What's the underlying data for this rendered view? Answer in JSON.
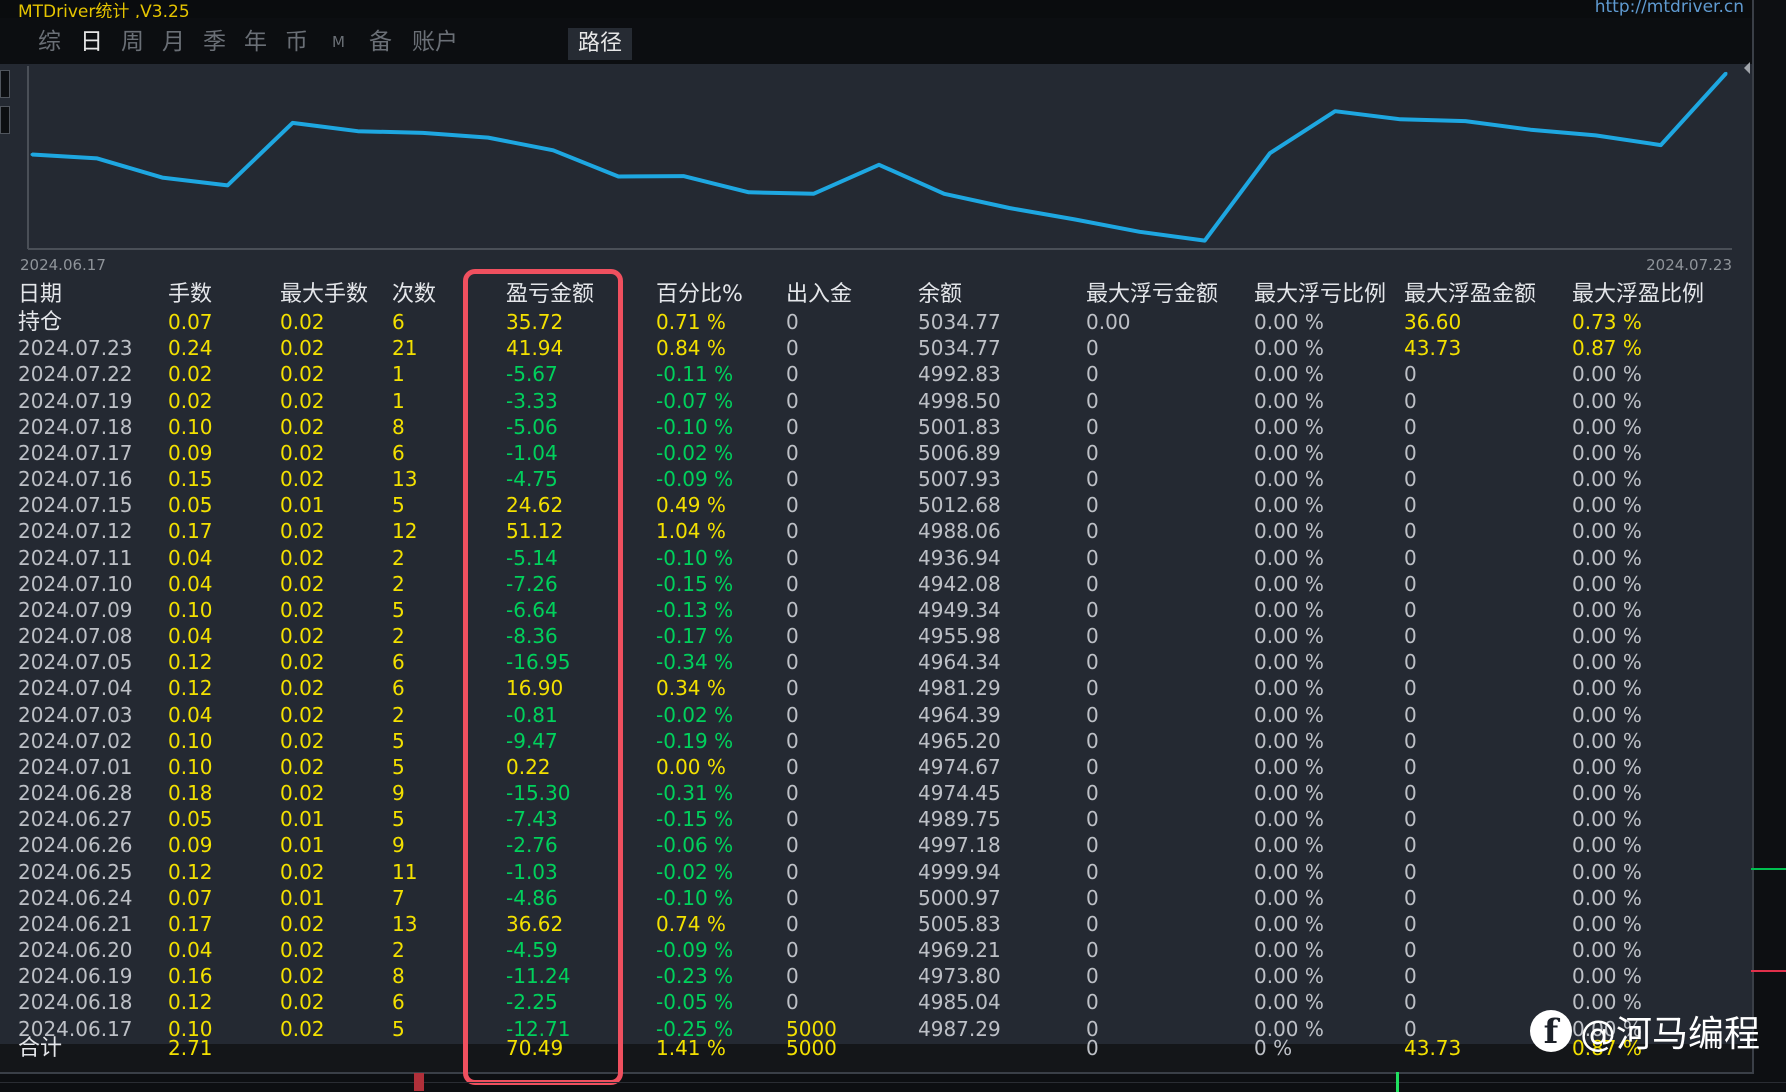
{
  "app": {
    "title": "MTDriver统计 ,V3.25",
    "url": "http://mtdriver.cn"
  },
  "tabs": [
    {
      "label": "综",
      "active": false
    },
    {
      "label": "日",
      "active": true
    },
    {
      "label": "周",
      "active": false
    },
    {
      "label": "月",
      "active": false
    },
    {
      "label": "季",
      "active": false
    },
    {
      "label": "年",
      "active": false
    },
    {
      "label": "币",
      "active": false
    },
    {
      "label": "M",
      "active": false
    },
    {
      "label": "备",
      "active": false
    },
    {
      "label": "账户",
      "active": false
    }
  ],
  "path_button": "路径",
  "chart_data": {
    "type": "line",
    "x_start_label": "2024.06.17",
    "x_end_label": "2024.07.23",
    "color": "#1ea7e1",
    "x": [
      "2024.06.17",
      "2024.06.18",
      "2024.06.19",
      "2024.06.20",
      "2024.06.21",
      "2024.06.24",
      "2024.06.25",
      "2024.06.26",
      "2024.06.27",
      "2024.06.28",
      "2024.07.01",
      "2024.07.02",
      "2024.07.03",
      "2024.07.04",
      "2024.07.05",
      "2024.07.08",
      "2024.07.09",
      "2024.07.10",
      "2024.07.11",
      "2024.07.12",
      "2024.07.15",
      "2024.07.16",
      "2024.07.17",
      "2024.07.18",
      "2024.07.19",
      "2024.07.22",
      "2024.07.23"
    ],
    "values": [
      4987.29,
      4985.04,
      4973.8,
      4969.21,
      5005.83,
      5000.97,
      4999.94,
      4997.18,
      4989.75,
      4974.45,
      4974.67,
      4965.2,
      4964.39,
      4981.29,
      4964.34,
      4955.98,
      4949.34,
      4942.08,
      4936.94,
      4988.06,
      5012.68,
      5007.93,
      5006.89,
      5001.83,
      4998.5,
      4992.83,
      5034.77
    ]
  },
  "table": {
    "headers": [
      "日期",
      "手数",
      "最大手数",
      "次数",
      "盈亏金额",
      "百分比%",
      "出入金",
      "余额",
      "最大浮亏金额",
      "最大浮亏比例",
      "最大浮盈金额",
      "最大浮盈比例"
    ],
    "position_row": [
      "持仓",
      "0.07",
      "0.02",
      "6",
      "35.72",
      "0.71 %",
      "0",
      "5034.77",
      "0.00",
      "0.00 %",
      "36.60",
      "0.73 %"
    ],
    "rows": [
      [
        "2024.07.23",
        "0.24",
        "0.02",
        "21",
        "41.94",
        "0.84 %",
        "0",
        "5034.77",
        "0",
        "0.00 %",
        "43.73",
        "0.87 %"
      ],
      [
        "2024.07.22",
        "0.02",
        "0.02",
        "1",
        "-5.67",
        "-0.11 %",
        "0",
        "4992.83",
        "0",
        "0.00 %",
        "0",
        "0.00 %"
      ],
      [
        "2024.07.19",
        "0.02",
        "0.02",
        "1",
        "-3.33",
        "-0.07 %",
        "0",
        "4998.50",
        "0",
        "0.00 %",
        "0",
        "0.00 %"
      ],
      [
        "2024.07.18",
        "0.10",
        "0.02",
        "8",
        "-5.06",
        "-0.10 %",
        "0",
        "5001.83",
        "0",
        "0.00 %",
        "0",
        "0.00 %"
      ],
      [
        "2024.07.17",
        "0.09",
        "0.02",
        "6",
        "-1.04",
        "-0.02 %",
        "0",
        "5006.89",
        "0",
        "0.00 %",
        "0",
        "0.00 %"
      ],
      [
        "2024.07.16",
        "0.15",
        "0.02",
        "13",
        "-4.75",
        "-0.09 %",
        "0",
        "5007.93",
        "0",
        "0.00 %",
        "0",
        "0.00 %"
      ],
      [
        "2024.07.15",
        "0.05",
        "0.01",
        "5",
        "24.62",
        "0.49 %",
        "0",
        "5012.68",
        "0",
        "0.00 %",
        "0",
        "0.00 %"
      ],
      [
        "2024.07.12",
        "0.17",
        "0.02",
        "12",
        "51.12",
        "1.04 %",
        "0",
        "4988.06",
        "0",
        "0.00 %",
        "0",
        "0.00 %"
      ],
      [
        "2024.07.11",
        "0.04",
        "0.02",
        "2",
        "-5.14",
        "-0.10 %",
        "0",
        "4936.94",
        "0",
        "0.00 %",
        "0",
        "0.00 %"
      ],
      [
        "2024.07.10",
        "0.04",
        "0.02",
        "2",
        "-7.26",
        "-0.15 %",
        "0",
        "4942.08",
        "0",
        "0.00 %",
        "0",
        "0.00 %"
      ],
      [
        "2024.07.09",
        "0.10",
        "0.02",
        "5",
        "-6.64",
        "-0.13 %",
        "0",
        "4949.34",
        "0",
        "0.00 %",
        "0",
        "0.00 %"
      ],
      [
        "2024.07.08",
        "0.04",
        "0.02",
        "2",
        "-8.36",
        "-0.17 %",
        "0",
        "4955.98",
        "0",
        "0.00 %",
        "0",
        "0.00 %"
      ],
      [
        "2024.07.05",
        "0.12",
        "0.02",
        "6",
        "-16.95",
        "-0.34 %",
        "0",
        "4964.34",
        "0",
        "0.00 %",
        "0",
        "0.00 %"
      ],
      [
        "2024.07.04",
        "0.12",
        "0.02",
        "6",
        "16.90",
        "0.34 %",
        "0",
        "4981.29",
        "0",
        "0.00 %",
        "0",
        "0.00 %"
      ],
      [
        "2024.07.03",
        "0.04",
        "0.02",
        "2",
        "-0.81",
        "-0.02 %",
        "0",
        "4964.39",
        "0",
        "0.00 %",
        "0",
        "0.00 %"
      ],
      [
        "2024.07.02",
        "0.10",
        "0.02",
        "5",
        "-9.47",
        "-0.19 %",
        "0",
        "4965.20",
        "0",
        "0.00 %",
        "0",
        "0.00 %"
      ],
      [
        "2024.07.01",
        "0.10",
        "0.02",
        "5",
        "0.22",
        "0.00 %",
        "0",
        "4974.67",
        "0",
        "0.00 %",
        "0",
        "0.00 %"
      ],
      [
        "2024.06.28",
        "0.18",
        "0.02",
        "9",
        "-15.30",
        "-0.31 %",
        "0",
        "4974.45",
        "0",
        "0.00 %",
        "0",
        "0.00 %"
      ],
      [
        "2024.06.27",
        "0.05",
        "0.01",
        "5",
        "-7.43",
        "-0.15 %",
        "0",
        "4989.75",
        "0",
        "0.00 %",
        "0",
        "0.00 %"
      ],
      [
        "2024.06.26",
        "0.09",
        "0.01",
        "9",
        "-2.76",
        "-0.06 %",
        "0",
        "4997.18",
        "0",
        "0.00 %",
        "0",
        "0.00 %"
      ],
      [
        "2024.06.25",
        "0.12",
        "0.02",
        "11",
        "-1.03",
        "-0.02 %",
        "0",
        "4999.94",
        "0",
        "0.00 %",
        "0",
        "0.00 %"
      ],
      [
        "2024.06.24",
        "0.07",
        "0.01",
        "7",
        "-4.86",
        "-0.10 %",
        "0",
        "5000.97",
        "0",
        "0.00 %",
        "0",
        "0.00 %"
      ],
      [
        "2024.06.21",
        "0.17",
        "0.02",
        "13",
        "36.62",
        "0.74 %",
        "0",
        "5005.83",
        "0",
        "0.00 %",
        "0",
        "0.00 %"
      ],
      [
        "2024.06.20",
        "0.04",
        "0.02",
        "2",
        "-4.59",
        "-0.09 %",
        "0",
        "4969.21",
        "0",
        "0.00 %",
        "0",
        "0.00 %"
      ],
      [
        "2024.06.19",
        "0.16",
        "0.02",
        "8",
        "-11.24",
        "-0.23 %",
        "0",
        "4973.80",
        "0",
        "0.00 %",
        "0",
        "0.00 %"
      ],
      [
        "2024.06.18",
        "0.12",
        "0.02",
        "6",
        "-2.25",
        "-0.05 %",
        "0",
        "4985.04",
        "0",
        "0.00 %",
        "0",
        "0.00 %"
      ],
      [
        "2024.06.17",
        "0.10",
        "0.02",
        "5",
        "-12.71",
        "-0.25 %",
        "5000",
        "4987.29",
        "0",
        "0.00 %",
        "0",
        "0.00 %"
      ]
    ],
    "total_row": [
      "合计",
      "2.71",
      "",
      "",
      "70.49",
      "1.41 %",
      "5000",
      "",
      "0",
      "0 %",
      "43.73",
      "0.87 %"
    ]
  },
  "watermark": {
    "icon": "facebook-icon",
    "text": "@河马编程"
  },
  "colors": {
    "positive": "#f3e000",
    "negative": "#00d15c",
    "line": "#1ea7e1",
    "highlight": "#f0505f"
  }
}
